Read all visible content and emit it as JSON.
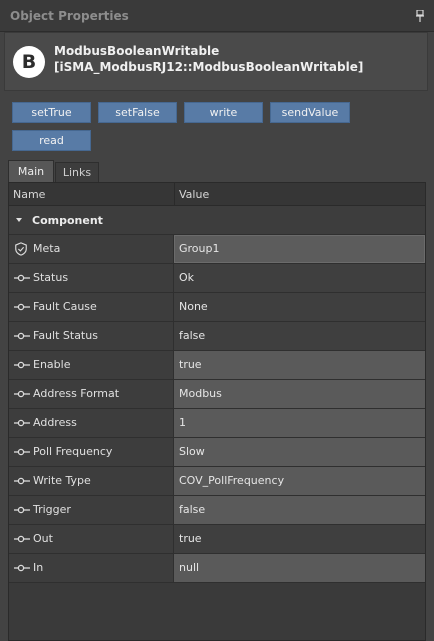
{
  "panel": {
    "title": "Object Properties"
  },
  "object": {
    "badge": "B",
    "name": "ModbusBooleanWritable",
    "type": "[iSMA_ModbusRJ12::ModbusBooleanWritable]"
  },
  "actions": [
    "setTrue",
    "setFalse",
    "write",
    "sendValue",
    "read"
  ],
  "tabs": [
    {
      "label": "Main",
      "active": true
    },
    {
      "label": "Links",
      "active": false
    }
  ],
  "table": {
    "columns": {
      "name": "Name",
      "value": "Value"
    },
    "group": "Component",
    "rows": [
      {
        "icon": "shield-icon",
        "name": "Meta",
        "value": "Group1"
      },
      {
        "icon": "slot-icon",
        "name": "Status",
        "value": "Ok"
      },
      {
        "icon": "slot-icon",
        "name": "Fault Cause",
        "value": "None"
      },
      {
        "icon": "slot-icon",
        "name": "Fault Status",
        "value": "false"
      },
      {
        "icon": "slot-icon",
        "name": "Enable",
        "value": "true"
      },
      {
        "icon": "slot-icon",
        "name": "Address Format",
        "value": "Modbus"
      },
      {
        "icon": "slot-icon",
        "name": "Address",
        "value": "1"
      },
      {
        "icon": "slot-icon",
        "name": "Poll Frequency",
        "value": "Slow"
      },
      {
        "icon": "slot-icon",
        "name": "Write Type",
        "value": "COV_PollFrequency"
      },
      {
        "icon": "slot-icon",
        "name": "Trigger",
        "value": "false"
      },
      {
        "icon": "slot-icon",
        "name": "Out",
        "value": "true"
      },
      {
        "icon": "slot-icon",
        "name": "In",
        "value": "null"
      }
    ]
  },
  "colors": {
    "background": "#434343",
    "button": "#587ba6",
    "editable_cell": "#5a5a5a",
    "readonly_cell": "#3f3f3f"
  }
}
